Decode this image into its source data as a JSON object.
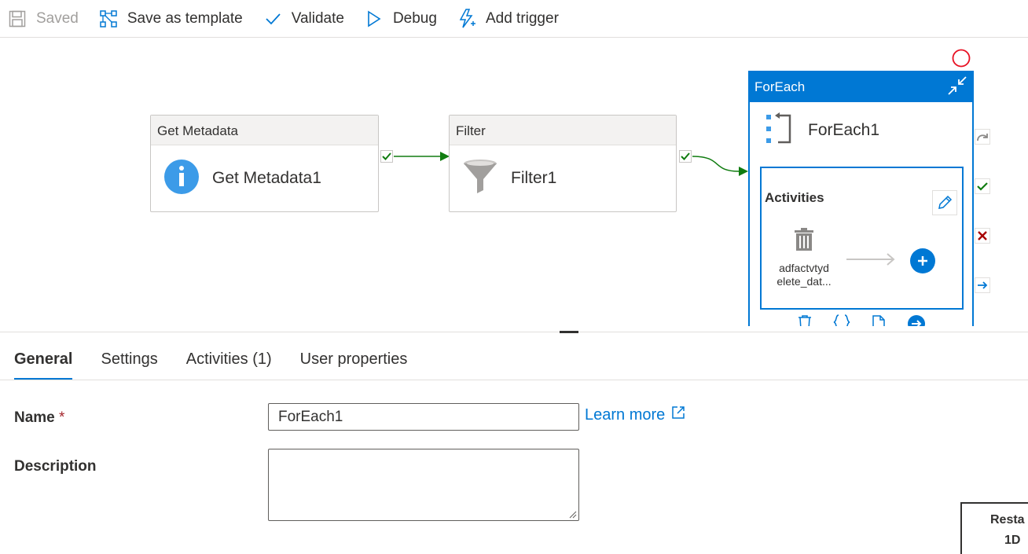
{
  "toolbar": {
    "saved_label": "Saved",
    "save_template_label": "Save as template",
    "validate_label": "Validate",
    "debug_label": "Debug",
    "add_trigger_label": "Add trigger"
  },
  "canvas": {
    "get_metadata": {
      "type_label": "Get Metadata",
      "name": "Get Metadata1"
    },
    "filter": {
      "type_label": "Filter",
      "name": "Filter1"
    },
    "foreach": {
      "type_label": "ForEach",
      "name": "ForEach1",
      "activities_label": "Activities",
      "child_activity_label": "adfactvtyd elete_dat..."
    }
  },
  "tabs": [
    {
      "label": "General",
      "active": true
    },
    {
      "label": "Settings",
      "active": false
    },
    {
      "label": "Activities (1)",
      "active": false
    },
    {
      "label": "User properties",
      "active": false
    }
  ],
  "form": {
    "name_label": "Name",
    "required_mark": "*",
    "name_value": "ForEach1",
    "learn_more_label": "Learn more",
    "description_label": "Description",
    "description_value": ""
  },
  "corner": {
    "line1": "Resta",
    "line2": "1D"
  },
  "colors": {
    "accent": "#0078d4",
    "success": "#107c10",
    "error": "#a80000",
    "status_ring": "#e81123"
  }
}
